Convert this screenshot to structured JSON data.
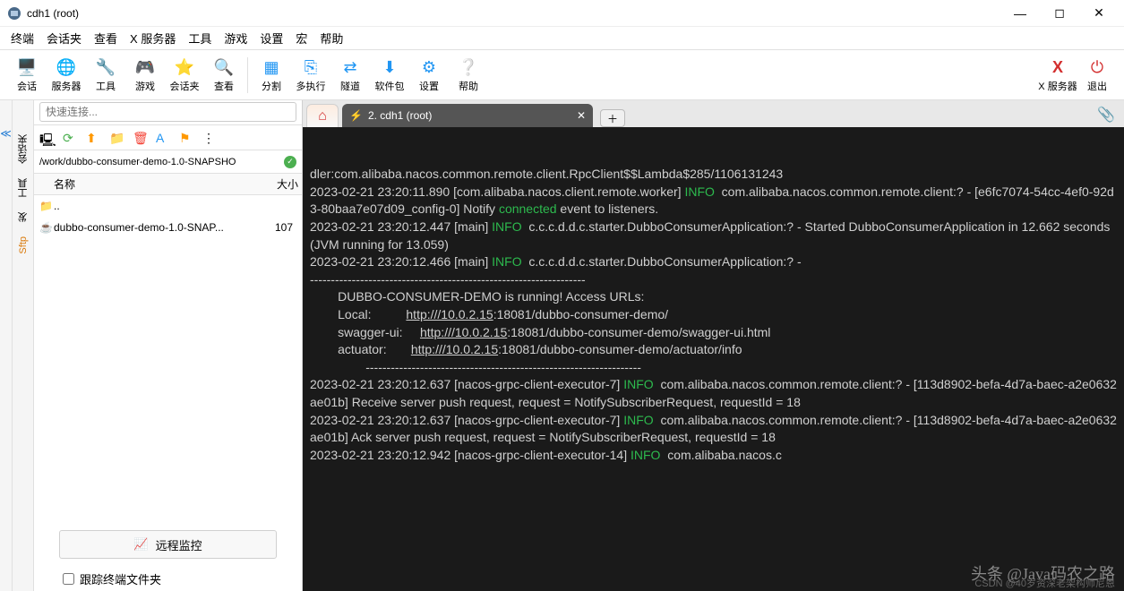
{
  "window": {
    "title": "cdh1 (root)"
  },
  "menubar": [
    "终端",
    "会话夹",
    "查看",
    "X 服务器",
    "工具",
    "游戏",
    "设置",
    "宏",
    "帮助"
  ],
  "toolbar": {
    "session": "会话",
    "server": "服务器",
    "tools": "工具",
    "games": "游戏",
    "sessions": "会话夹",
    "view": "查看",
    "split": "分割",
    "multiexec": "多执行",
    "tunnel": "隧道",
    "packages": "软件包",
    "settings": "设置",
    "help": "帮助",
    "xserver": "X 服务器",
    "exit": "退出"
  },
  "sidebar": {
    "quick_placeholder": "快速连接...",
    "path": "/work/dubbo-consumer-demo-1.0-SNAPSHO",
    "col_name": "名称",
    "col_size": "大小",
    "rows": [
      {
        "name": "..",
        "size": ""
      },
      {
        "name": "dubbo-consumer-demo-1.0-SNAP...",
        "size": "107"
      }
    ],
    "remote_monitor": "远程监控",
    "follow_terminal": "跟踪终端文件夹"
  },
  "vtabs": {
    "session": "会话夹",
    "tools": "工具",
    "send": "发",
    "sftp": "Sftp"
  },
  "tabs": {
    "active": "2. cdh1 (root)"
  },
  "terminal": {
    "lines": [
      {
        "text": "dler:com.alibaba.nacos.common.remote.client.RpcClient$$Lambda$285/1106131243"
      },
      {
        "parts": [
          "2023-02-21 23:20:11.890 [com.alibaba.nacos.client.remote.worker] ",
          {
            "class": "info",
            "t": "INFO"
          },
          "  com.alibaba.nacos.common.remote.client:? - [e6fc7074-54cc-4ef0-92d3-80baa7e07d09_config-0] Notify ",
          {
            "class": "connected",
            "t": "connected"
          },
          " event to listeners."
        ]
      },
      {
        "parts": [
          "2023-02-21 23:20:12.447 [main] ",
          {
            "class": "info",
            "t": "INFO"
          },
          "  c.c.c.d.d.c.starter.DubboConsumerApplication:? - Started DubboConsumerApplication in 12.662 seconds (JVM running for 13.059)"
        ]
      },
      {
        "parts": [
          "2023-02-21 23:20:12.466 [main] ",
          {
            "class": "info",
            "t": "INFO"
          },
          "  c.c.c.d.d.c.starter.DubboConsumerApplication:? - "
        ]
      },
      {
        "text": "------------------------------------------------------------------"
      },
      {
        "text": "        DUBBO-CONSUMER-DEMO is running! Access URLs:"
      },
      {
        "parts": [
          "        Local:          ",
          {
            "class": "link",
            "t": "http:///10.0.2.15"
          },
          ":18081/dubbo-consumer-demo/"
        ]
      },
      {
        "parts": [
          "        swagger-ui:     ",
          {
            "class": "link",
            "t": "http:///10.0.2.15"
          },
          ":18081/dubbo-consumer-demo/swagger-ui.html"
        ]
      },
      {
        "parts": [
          "        actuator:       ",
          {
            "class": "link",
            "t": "http:///10.0.2.15"
          },
          ":18081/dubbo-consumer-demo/actuator/info"
        ]
      },
      {
        "text": "                ------------------------------------------------------------------"
      },
      {
        "parts": [
          "2023-02-21 23:20:12.637 [nacos-grpc-client-executor-7] ",
          {
            "class": "info",
            "t": "INFO"
          },
          "  com.alibaba.nacos.common.remote.client:? - [113d8902-befa-4d7a-baec-a2e0632ae01b] Receive server push request, request = NotifySubscriberRequest, requestId = 18"
        ]
      },
      {
        "parts": [
          "2023-02-21 23:20:12.637 [nacos-grpc-client-executor-7] ",
          {
            "class": "info",
            "t": "INFO"
          },
          "  com.alibaba.nacos.common.remote.client:? - [113d8902-befa-4d7a-baec-a2e0632ae01b] Ack server push request, request = NotifySubscriberRequest, requestId = 18"
        ]
      },
      {
        "parts": [
          "2023-02-21 23:20:12.942 [nacos-grpc-client-executor-14] ",
          {
            "class": "info",
            "t": "INFO"
          },
          "  com.alibaba.nacos.c"
        ]
      }
    ],
    "watermark1": "头条 @Java码农之路",
    "watermark2": "CSDN @40岁资深老架构师尼恩"
  }
}
